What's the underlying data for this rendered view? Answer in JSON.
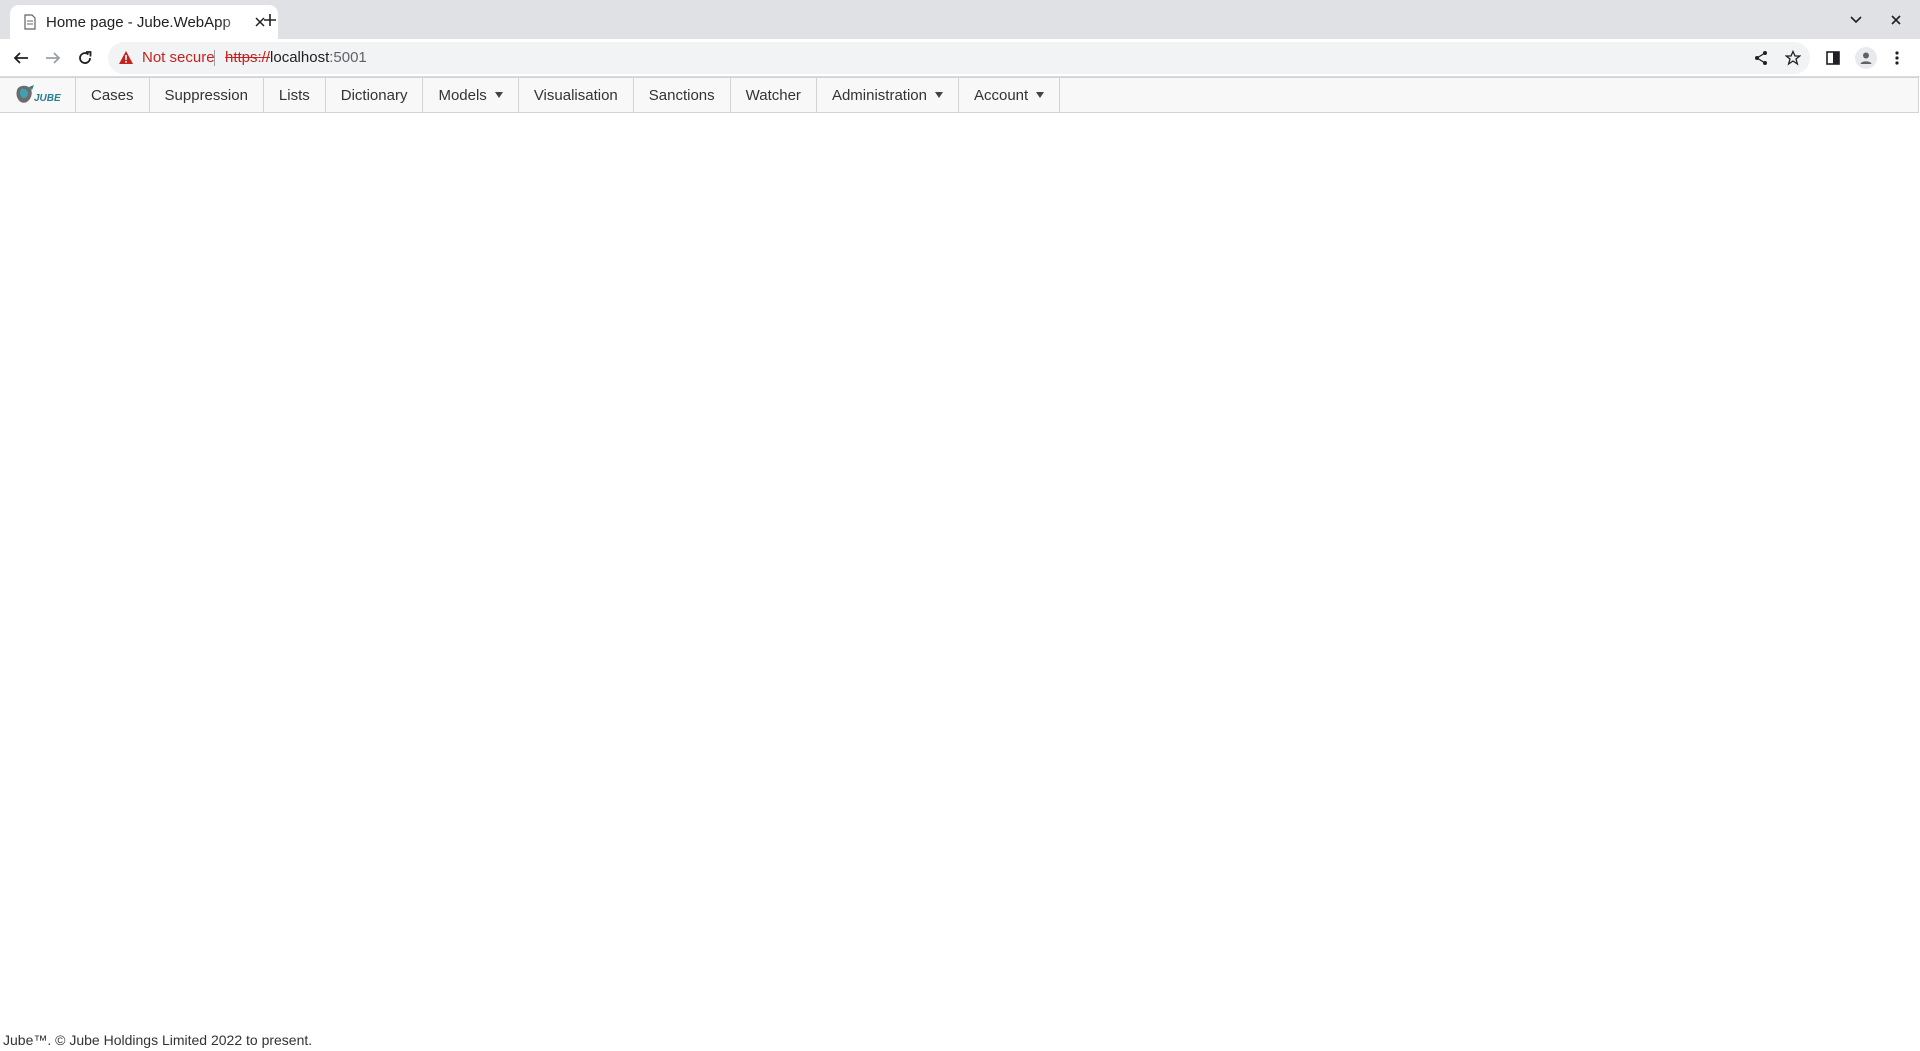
{
  "browser": {
    "tab": {
      "title": "Home page - Jube.WebApp",
      "favicon": "document-icon"
    },
    "omnibox": {
      "security_label": "Not secure",
      "url_scheme": "https://",
      "url_host": "localhost",
      "url_rest": ":5001"
    }
  },
  "app": {
    "logo_text": "JUBE",
    "menu": [
      {
        "label": "Cases",
        "dropdown": false
      },
      {
        "label": "Suppression",
        "dropdown": false
      },
      {
        "label": "Lists",
        "dropdown": false
      },
      {
        "label": "Dictionary",
        "dropdown": false
      },
      {
        "label": "Models",
        "dropdown": true
      },
      {
        "label": "Visualisation",
        "dropdown": false
      },
      {
        "label": "Sanctions",
        "dropdown": false
      },
      {
        "label": "Watcher",
        "dropdown": false
      },
      {
        "label": "Administration",
        "dropdown": true
      },
      {
        "label": "Account",
        "dropdown": true
      }
    ]
  },
  "footer": {
    "text": "Jube™. © Jube Holdings Limited 2022 to present."
  },
  "colors": {
    "warning_red": "#c5221f",
    "menubar_bg": "#f8f8f8",
    "logo_teal": "#2a7f8f"
  }
}
